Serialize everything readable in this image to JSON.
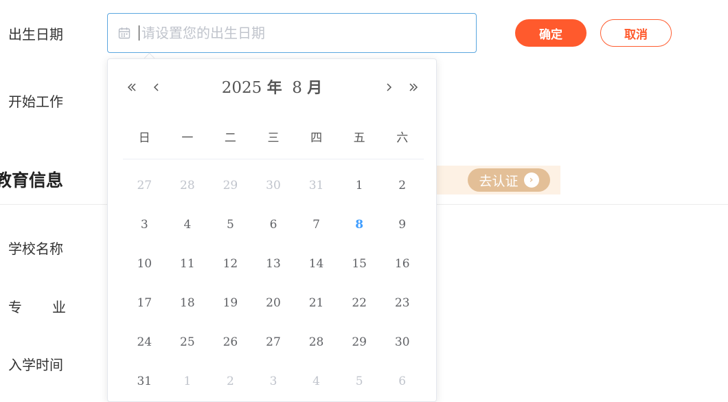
{
  "form": {
    "birth_label": "出生日期",
    "work_label": "开始工作",
    "birth_placeholder": "请设置您的出生日期",
    "confirm_label": "确定",
    "cancel_label": "取消"
  },
  "education": {
    "section_title": "教育信息",
    "verify_label": "去认证",
    "school_label": "学校名称",
    "major_chars": [
      "专",
      "业"
    ],
    "enroll_label": "入学时间"
  },
  "calendar": {
    "year": "2025",
    "year_unit": "年",
    "month": "8",
    "month_unit": "月",
    "weekdays": [
      "日",
      "一",
      "二",
      "三",
      "四",
      "五",
      "六"
    ],
    "days": [
      {
        "d": "27",
        "muted": true
      },
      {
        "d": "28",
        "muted": true
      },
      {
        "d": "29",
        "muted": true
      },
      {
        "d": "30",
        "muted": true
      },
      {
        "d": "31",
        "muted": true
      },
      {
        "d": "1"
      },
      {
        "d": "2"
      },
      {
        "d": "3"
      },
      {
        "d": "4"
      },
      {
        "d": "5"
      },
      {
        "d": "6"
      },
      {
        "d": "7"
      },
      {
        "d": "8",
        "today": true
      },
      {
        "d": "9"
      },
      {
        "d": "10"
      },
      {
        "d": "11"
      },
      {
        "d": "12"
      },
      {
        "d": "13"
      },
      {
        "d": "14"
      },
      {
        "d": "15"
      },
      {
        "d": "16"
      },
      {
        "d": "17"
      },
      {
        "d": "18"
      },
      {
        "d": "19"
      },
      {
        "d": "20"
      },
      {
        "d": "21"
      },
      {
        "d": "22"
      },
      {
        "d": "23"
      },
      {
        "d": "24"
      },
      {
        "d": "25"
      },
      {
        "d": "26"
      },
      {
        "d": "27"
      },
      {
        "d": "28"
      },
      {
        "d": "29"
      },
      {
        "d": "30"
      },
      {
        "d": "31"
      },
      {
        "d": "1",
        "muted": true
      },
      {
        "d": "2",
        "muted": true
      },
      {
        "d": "3",
        "muted": true
      },
      {
        "d": "4",
        "muted": true
      },
      {
        "d": "5",
        "muted": true
      },
      {
        "d": "6",
        "muted": true
      }
    ]
  },
  "icons": {
    "input_icon": "calendar-icon",
    "verify_icon": "chevron-right-circle-icon"
  },
  "colors": {
    "primary": "#ff5a2d",
    "focus_border": "#5aa6df",
    "today": "#409eff",
    "verify_bg": "#e3bf97",
    "banner_bg": "#fdf1e4"
  }
}
